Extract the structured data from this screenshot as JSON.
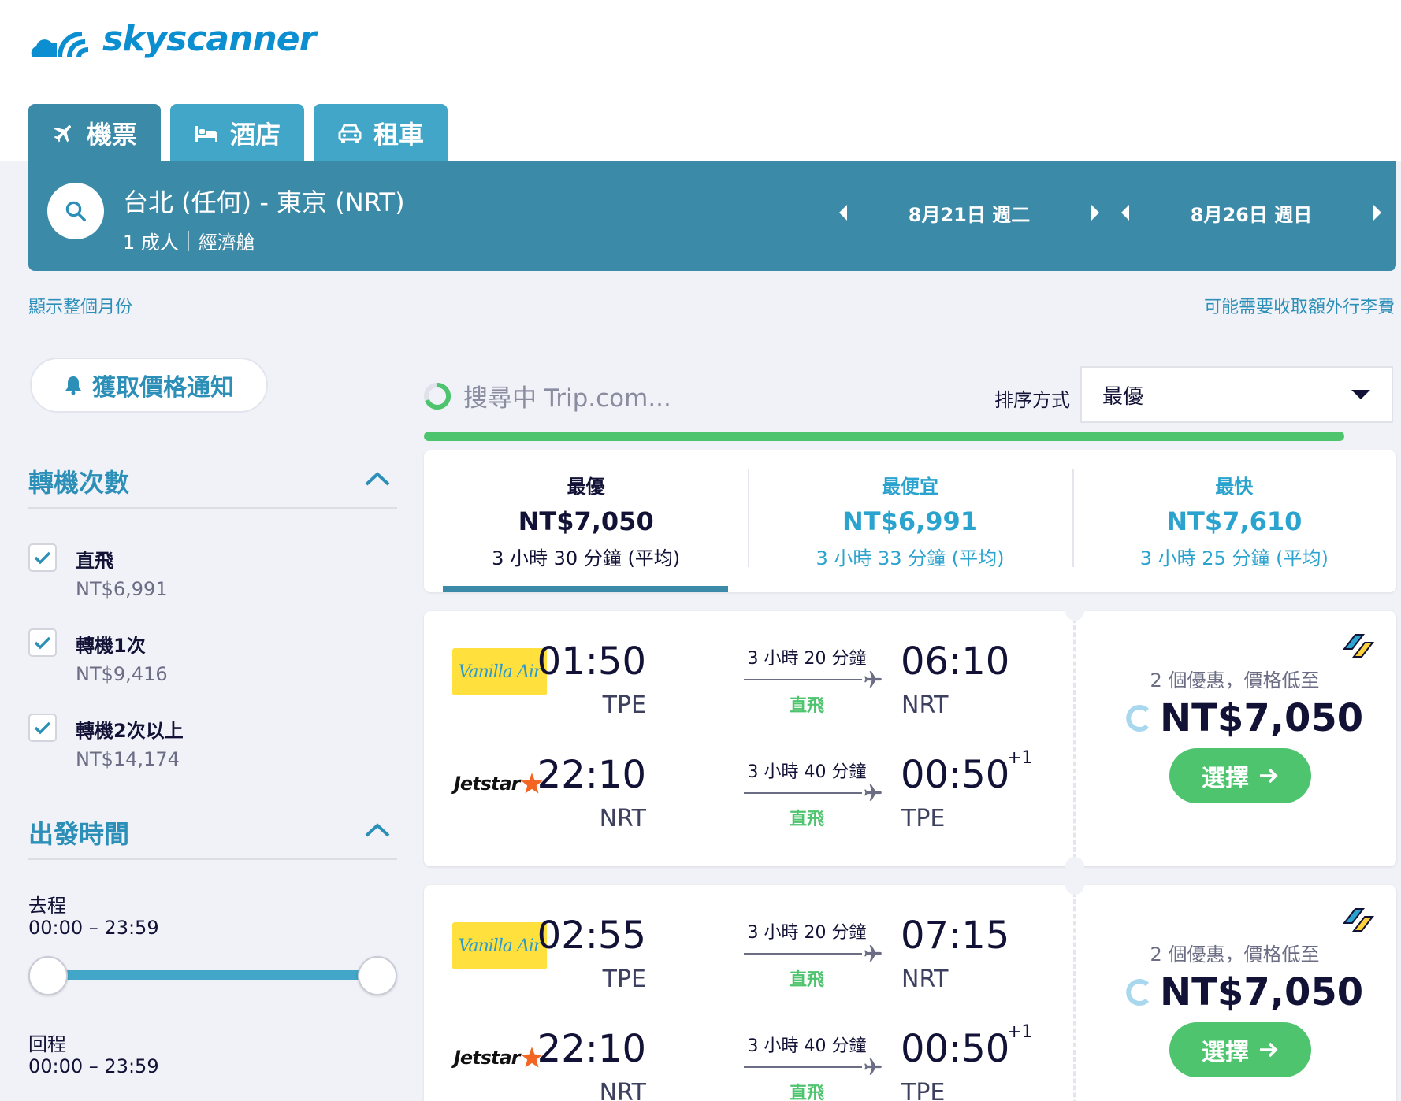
{
  "brand": {
    "name": "skyscanner",
    "color": "#0b8fd0"
  },
  "tabs": [
    {
      "label": "機票",
      "icon": "plane-icon"
    },
    {
      "label": "酒店",
      "icon": "bed-icon"
    },
    {
      "label": "租車",
      "icon": "car-icon"
    }
  ],
  "search": {
    "route": "台北 (任何) - 東京 (NRT)",
    "passengers": "1 成人",
    "cabin": "經濟艙",
    "outbound_date": "8月21日 週二",
    "return_date": "8月26日 週日"
  },
  "links": {
    "show_month": "顯示整個月份",
    "baggage_fee": "可能需要收取額外行李費"
  },
  "price_alert": {
    "label": "獲取價格通知"
  },
  "filters": {
    "stops": {
      "title": "轉機次數",
      "items": [
        {
          "label": "直飛",
          "price": "NT$6,991",
          "checked": true
        },
        {
          "label": "轉機1次",
          "price": "NT$9,416",
          "checked": true
        },
        {
          "label": "轉機2次以上",
          "price": "NT$14,174",
          "checked": true
        }
      ]
    },
    "departure": {
      "title": "出發時間",
      "outbound_label": "去程",
      "outbound_range": "00:00 – 23:59",
      "return_label": "回程",
      "return_range": "00:00 – 23:59"
    }
  },
  "status": {
    "loading": "搜尋中 Trip.com...",
    "progress": 0.99
  },
  "sort": {
    "label": "排序方式",
    "selected": "最優"
  },
  "summary": [
    {
      "title": "最優",
      "price": "NT$7,050",
      "duration": "3 小時 30 分鐘 (平均)"
    },
    {
      "title": "最便宜",
      "price": "NT$6,991",
      "duration": "3 小時 33 分鐘 (平均)"
    },
    {
      "title": "最快",
      "price": "NT$7,610",
      "duration": "3 小時 25 分鐘 (平均)"
    }
  ],
  "results": [
    {
      "legs": [
        {
          "airline": "Vanilla Air",
          "dep_time": "01:50",
          "dep_code": "TPE",
          "duration": "3 小時 20 分鐘",
          "stops": "直飛",
          "arr_time": "06:10",
          "arr_code": "NRT",
          "day_offset": ""
        },
        {
          "airline": "Jetstar",
          "dep_time": "22:10",
          "dep_code": "NRT",
          "duration": "3 小時 40 分鐘",
          "stops": "直飛",
          "arr_time": "00:50",
          "arr_code": "TPE",
          "day_offset": "+1"
        }
      ],
      "deals": "2 個優惠，價格低至",
      "price": "NT$7,050",
      "select_label": "選擇"
    },
    {
      "legs": [
        {
          "airline": "Vanilla Air",
          "dep_time": "02:55",
          "dep_code": "TPE",
          "duration": "3 小時 20 分鐘",
          "stops": "直飛",
          "arr_time": "07:15",
          "arr_code": "NRT",
          "day_offset": ""
        },
        {
          "airline": "Jetstar",
          "dep_time": "22:10",
          "dep_code": "NRT",
          "duration": "3 小時 40 分鐘",
          "stops": "直飛",
          "arr_time": "00:50",
          "arr_code": "TPE",
          "day_offset": "+1"
        }
      ],
      "deals": "2 個優惠，價格低至",
      "price": "NT$7,050",
      "select_label": "選擇"
    }
  ]
}
